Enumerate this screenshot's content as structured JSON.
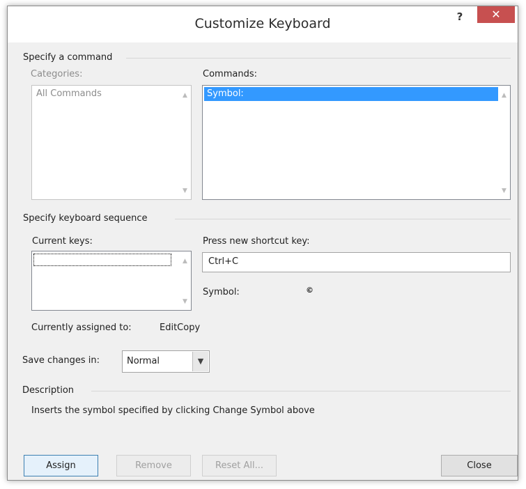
{
  "dialog": {
    "title": "Customize Keyboard",
    "help_label": "?",
    "close_glyph": "✕"
  },
  "specify_command": {
    "section_label": "Specify a command",
    "categories_label": "Categories:",
    "categories": [
      "All Commands"
    ],
    "commands_label": "Commands:",
    "commands": [
      "Symbol:"
    ],
    "selected_command": "Symbol:"
  },
  "keyboard_sequence": {
    "section_label": "Specify keyboard sequence",
    "current_keys_label": "Current keys:",
    "current_keys": [],
    "new_shortcut_label": "Press new shortcut key:",
    "new_shortcut_value": "Ctrl+C",
    "symbol_label": "Symbol:",
    "symbol_glyph": "©",
    "assigned_label": "Currently assigned to:",
    "assigned_value": "EditCopy"
  },
  "save_changes": {
    "label": "Save changes in:",
    "selected": "Normal"
  },
  "description": {
    "section_label": "Description",
    "text": "Inserts the symbol specified by clicking Change Symbol above"
  },
  "buttons": {
    "assign": "Assign",
    "remove": "Remove",
    "reset_all": "Reset All...",
    "close": "Close"
  },
  "colors": {
    "close_button_red": "#c75050",
    "selection_blue": "#3399ff",
    "dialog_background": "#f0f0f0"
  },
  "icons": {
    "scroll_up": "chevron-up-icon",
    "scroll_down": "chevron-down-icon",
    "dropdown": "chevron-down-icon"
  }
}
